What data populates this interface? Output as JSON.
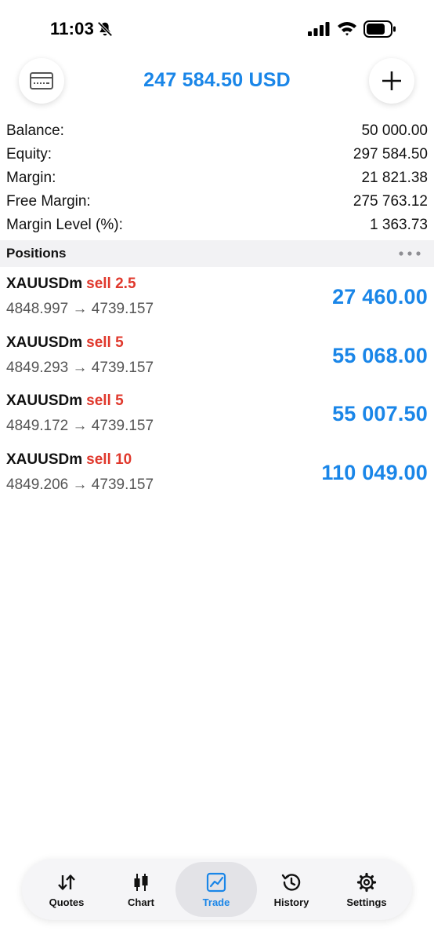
{
  "status_bar": {
    "time": "11:03"
  },
  "header": {
    "title": "247 584.50 USD",
    "left_icon": "card-icon",
    "right_icon": "plus-icon"
  },
  "summary": [
    {
      "label": "Balance:",
      "value": "50 000.00"
    },
    {
      "label": "Equity:",
      "value": "297 584.50"
    },
    {
      "label": "Margin:",
      "value": "21 821.38"
    },
    {
      "label": "Free Margin:",
      "value": "275 763.12"
    },
    {
      "label": "Margin Level (%):",
      "value": "1 363.73"
    }
  ],
  "positions_header": {
    "title": "Positions"
  },
  "positions": [
    {
      "symbol": "XAUUSDm",
      "side": "sell 2.5",
      "prices": "4848.997 → 4739.157",
      "profit": "27 460.00"
    },
    {
      "symbol": "XAUUSDm",
      "side": "sell 5",
      "prices": "4849.293 → 4739.157",
      "profit": "55 068.00"
    },
    {
      "symbol": "XAUUSDm",
      "side": "sell 5",
      "prices": "4849.172 → 4739.157",
      "profit": "55 007.50"
    },
    {
      "symbol": "XAUUSDm",
      "side": "sell 10",
      "prices": "4849.206 → 4739.157",
      "profit": "110 049.00"
    }
  ],
  "tabs": [
    {
      "label": "Quotes",
      "icon": "quotes-arrows-icon"
    },
    {
      "label": "Chart",
      "icon": "candlestick-icon"
    },
    {
      "label": "Trade",
      "icon": "trade-chart-icon",
      "active": true
    },
    {
      "label": "History",
      "icon": "history-clock-icon"
    },
    {
      "label": "Settings",
      "icon": "gear-icon"
    }
  ],
  "colors": {
    "accent": "#1a86e8",
    "sell": "#e0382c",
    "muted_text": "#555555",
    "section_bg": "#f2f2f4"
  }
}
